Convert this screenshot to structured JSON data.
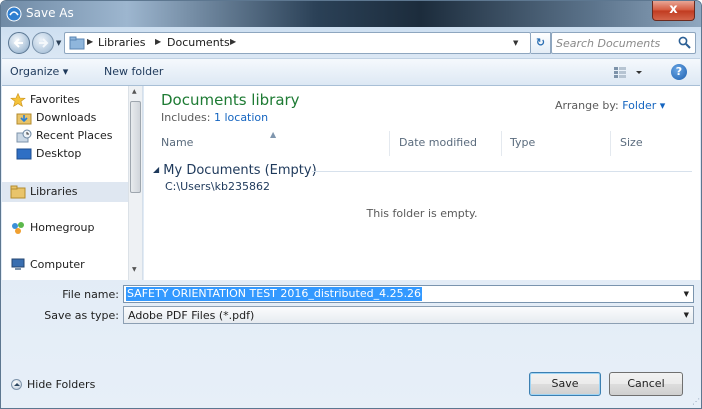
{
  "window": {
    "title": "Save As",
    "close_label": "x"
  },
  "address": {
    "crumbs": [
      "Libraries",
      "Documents"
    ],
    "search_placeholder": "Search Documents"
  },
  "toolbar": {
    "organize_label": "Organize ▾",
    "new_folder_label": "New folder"
  },
  "nav": {
    "items": [
      {
        "label": "Favorites",
        "icon": "star-icon"
      },
      {
        "label": "Downloads",
        "icon": "downloads-folder-icon"
      },
      {
        "label": "Recent Places",
        "icon": "recent-places-icon"
      },
      {
        "label": "Desktop",
        "icon": "desktop-icon"
      },
      {
        "label": "Libraries",
        "icon": "libraries-icon",
        "selected": true
      },
      {
        "label": "Homegroup",
        "icon": "homegroup-icon"
      },
      {
        "label": "Computer",
        "icon": "computer-icon"
      }
    ]
  },
  "library": {
    "title": "Documents library",
    "includes_prefix": "Includes:",
    "includes_link": "1 location",
    "arrange_label": "Arrange by:",
    "arrange_value": "Folder ▾",
    "columns": [
      "Name",
      "Date modified",
      "Type",
      "Size"
    ],
    "group_title": "My Documents (Empty)",
    "group_path": "C:\\Users\\kb235862",
    "empty_message": "This folder is empty."
  },
  "form": {
    "file_name_label": "File name:",
    "file_name_value": "SAFETY ORIENTATION TEST 2016_distributed_4.25.26",
    "save_type_label": "Save as type:",
    "save_type_value": "Adobe PDF Files (*.pdf)"
  },
  "footer": {
    "hide_folders_label": "Hide Folders",
    "save_label": "Save",
    "cancel_label": "Cancel"
  },
  "colors": {
    "accent": "#1565c0",
    "library_title": "#1e7b34",
    "selection": "#3399ff"
  }
}
